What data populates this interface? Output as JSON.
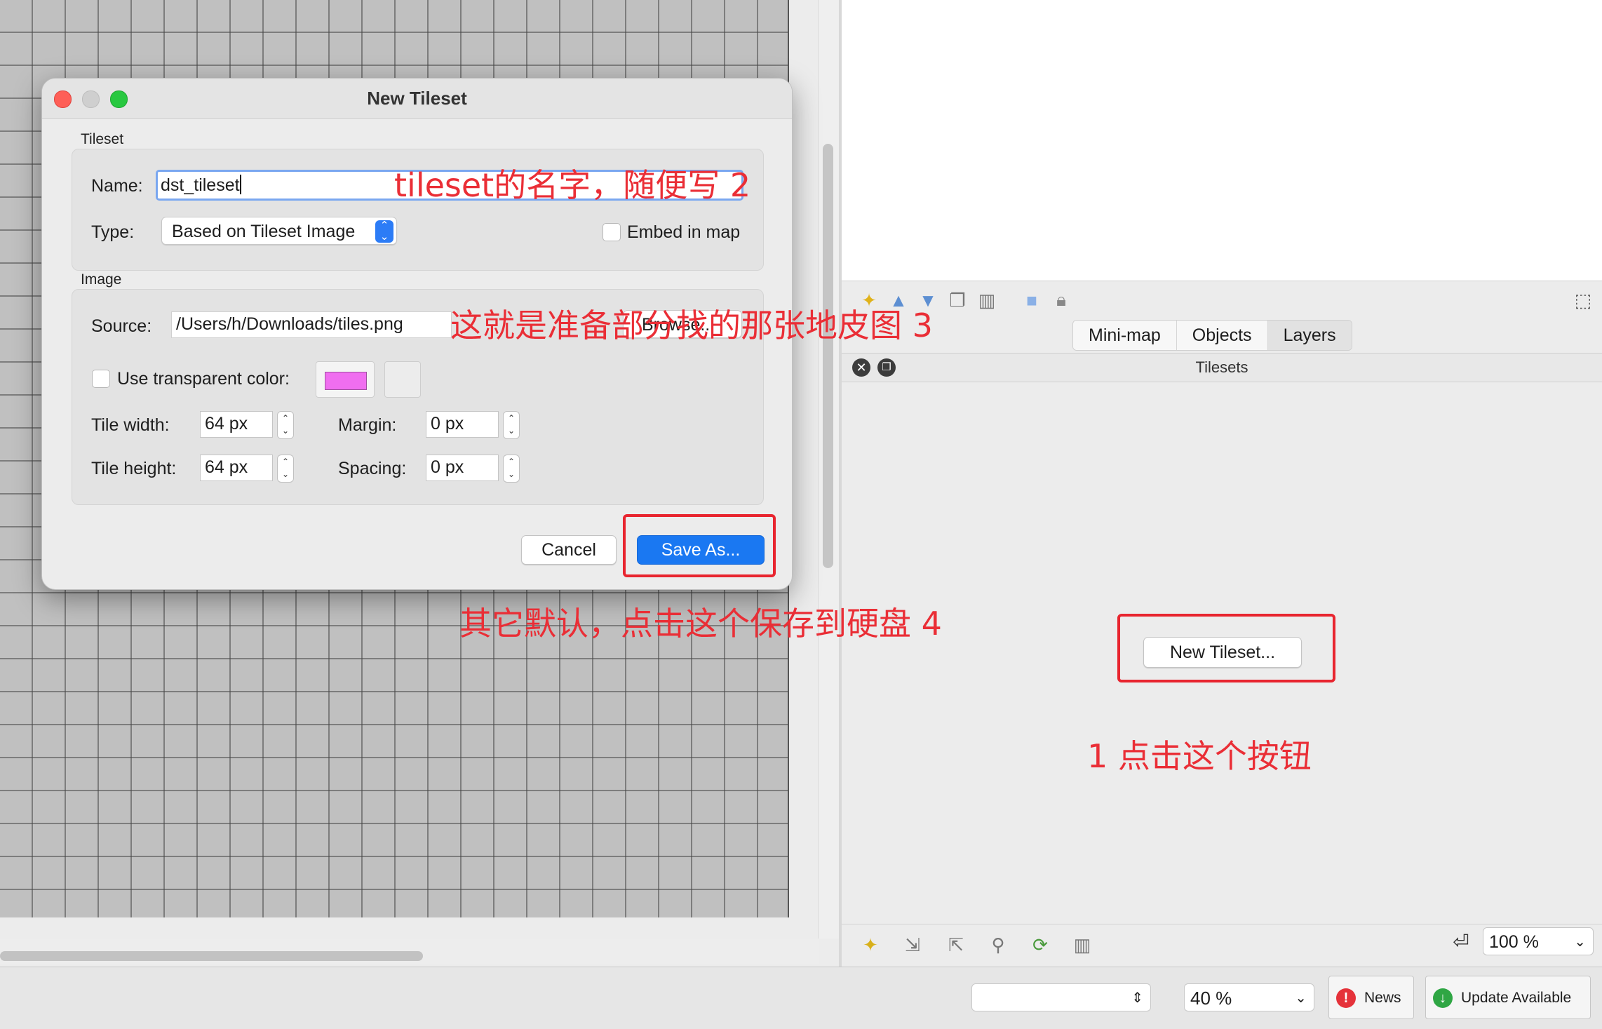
{
  "dialog": {
    "title": "New Tileset",
    "tileset_group": "Tileset",
    "name_label": "Name:",
    "name_value": "dst_tileset",
    "type_label": "Type:",
    "type_value": "Based on Tileset Image",
    "embed_label": "Embed in map",
    "image_group": "Image",
    "source_label": "Source:",
    "source_value": "/Users/h/Downloads/tiles.png",
    "browse_label": "Browse...",
    "transparent_label": "Use transparent color:",
    "transparent_color": "#f06ef0",
    "tile_width_label": "Tile width:",
    "tile_width_value": "64 px",
    "tile_height_label": "Tile height:",
    "tile_height_value": "64 px",
    "margin_label": "Margin:",
    "margin_value": "0 px",
    "spacing_label": "Spacing:",
    "spacing_value": "0 px",
    "cancel_label": "Cancel",
    "save_label": "Save As..."
  },
  "panel": {
    "tabs": [
      "Mini-map",
      "Objects",
      "Layers"
    ],
    "tilesets_title": "Tilesets",
    "new_tileset_label": "New Tileset...",
    "zoom_value": "100 %"
  },
  "statusbar": {
    "layer_combo_value": "",
    "zoom_value": "40 %",
    "news_label": "News",
    "update_label": "Update Available"
  },
  "annotations": {
    "a1": "1  点击这个按钮",
    "a2": "tileset的名字，随便写  2",
    "a3": "这就是准备部分找的那张地皮图  3",
    "a4": "其它默认，点击这个保存到硬盘   4"
  },
  "colors": {
    "annotation_red": "#ea2e36",
    "accent_blue": "#1a78f2",
    "close_red": "#fe5f57",
    "maximize_green": "#28c840"
  }
}
